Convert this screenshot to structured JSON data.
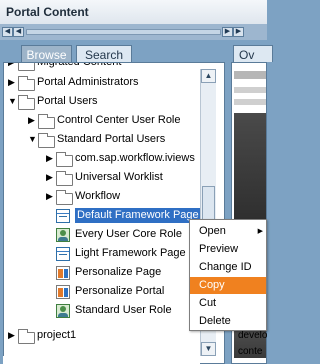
{
  "window": {
    "title": "Portal Content"
  },
  "tabs": [
    {
      "label": "Browse",
      "selected": true
    },
    {
      "label": "Search",
      "selected": false
    }
  ],
  "right_tab": {
    "label": "Ov"
  },
  "tree": {
    "rows": [
      {
        "label": "Migrated Content",
        "indent": 1,
        "icon": "folder-icon",
        "expander": "collapsed"
      },
      {
        "label": "Portal Administrators",
        "indent": 1,
        "icon": "folder-icon",
        "expander": "collapsed"
      },
      {
        "label": "Portal Users",
        "indent": 1,
        "icon": "folder-icon",
        "expander": "expanded"
      },
      {
        "label": "Control Center User Role",
        "indent": 2,
        "icon": "folder-icon",
        "expander": "collapsed"
      },
      {
        "label": "Standard Portal Users",
        "indent": 2,
        "icon": "folder-icon",
        "expander": "expanded"
      },
      {
        "label": "com.sap.workflow.iviews",
        "indent": 3,
        "icon": "folder-icon",
        "expander": "collapsed"
      },
      {
        "label": "Universal Worklist",
        "indent": 3,
        "icon": "folder-icon",
        "expander": "collapsed"
      },
      {
        "label": "Workflow",
        "indent": 3,
        "icon": "folder-icon",
        "expander": "collapsed"
      },
      {
        "label": "Default Framework Page",
        "indent": 3,
        "icon": "page-icon",
        "expander": "none",
        "selected": true
      },
      {
        "label": "Every User Core Role",
        "indent": 3,
        "icon": "role-icon",
        "expander": "none"
      },
      {
        "label": "Light Framework Page",
        "indent": 3,
        "icon": "page-icon",
        "expander": "none"
      },
      {
        "label": "Personalize Page",
        "indent": 3,
        "icon": "portal-icon",
        "expander": "none"
      },
      {
        "label": "Personalize Portal",
        "indent": 3,
        "icon": "portal-icon",
        "expander": "none"
      },
      {
        "label": "Standard User Role",
        "indent": 3,
        "icon": "role-icon",
        "expander": "none"
      },
      {
        "label": "project1",
        "indent": 1,
        "icon": "folder-icon",
        "expander": "collapsed"
      }
    ]
  },
  "context_menu": {
    "items": [
      {
        "label": "Open",
        "submenu": true
      },
      {
        "label": "Preview"
      },
      {
        "label": "Change ID"
      },
      {
        "label": "Copy",
        "highlighted": true
      },
      {
        "label": "Cut"
      },
      {
        "label": "Delete"
      }
    ]
  },
  "preview_text": [
    "develo",
    "conte"
  ],
  "colors": {
    "accent": "#f0811f",
    "selection": "#2f6fc4",
    "panel": "#7da2c3"
  }
}
